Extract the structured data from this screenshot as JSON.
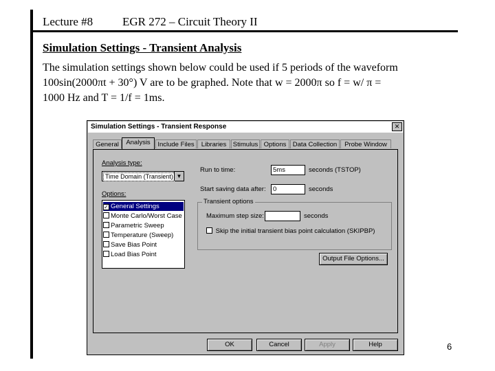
{
  "header": {
    "lecture": "Lecture #8",
    "course": "EGR 272 – Circuit Theory II"
  },
  "slide": {
    "title": "Simulation Settings - Transient Analysis",
    "body_lines": [
      "The simulation settings shown below could be used if 5 periods of the waveform",
      "100sin(2000πt + 30°) V are to be graphed.  Note that w = 2000π so f = w/ π  =",
      "1000 Hz and T = 1/f = 1ms."
    ],
    "page_number": "6"
  },
  "dialog": {
    "title": "Simulation Settings - Transient Response",
    "close_glyph": "✕",
    "tabs": [
      "General",
      "Analysis",
      "Include Files",
      "Libraries",
      "Stimulus",
      "Options",
      "Data Collection",
      "Probe Window"
    ],
    "active_tab": "Analysis",
    "analysis_type_label": "Analysis type:",
    "analysis_type_value": "Time Domain (Transient)",
    "options_label": "Options:",
    "options": [
      {
        "label": "General Settings",
        "checked": true,
        "selected": true
      },
      {
        "label": "Monte Carlo/Worst Case",
        "checked": false
      },
      {
        "label": "Parametric Sweep",
        "checked": false
      },
      {
        "label": "Temperature (Sweep)",
        "checked": false
      },
      {
        "label": "Save Bias Point",
        "checked": false
      },
      {
        "label": "Load Bias Point",
        "checked": false
      }
    ],
    "run_to_time_label": "Run to time:",
    "run_to_time_value": "5ms",
    "run_to_time_unit": "seconds (TSTOP)",
    "start_saving_label": "Start saving data after:",
    "start_saving_value": "0",
    "start_saving_unit": "seconds",
    "transient_group": "Transient options",
    "max_step_label": "Maximum step size:",
    "max_step_value": "",
    "max_step_unit": "seconds",
    "skip_bias_label": "Skip the initial transient bias point calculation (SKIPBP)",
    "skip_bias_checked": false,
    "output_file_button": "Output File Options...",
    "buttons": {
      "ok": "OK",
      "cancel": "Cancel",
      "apply": "Apply",
      "help": "Help"
    }
  }
}
